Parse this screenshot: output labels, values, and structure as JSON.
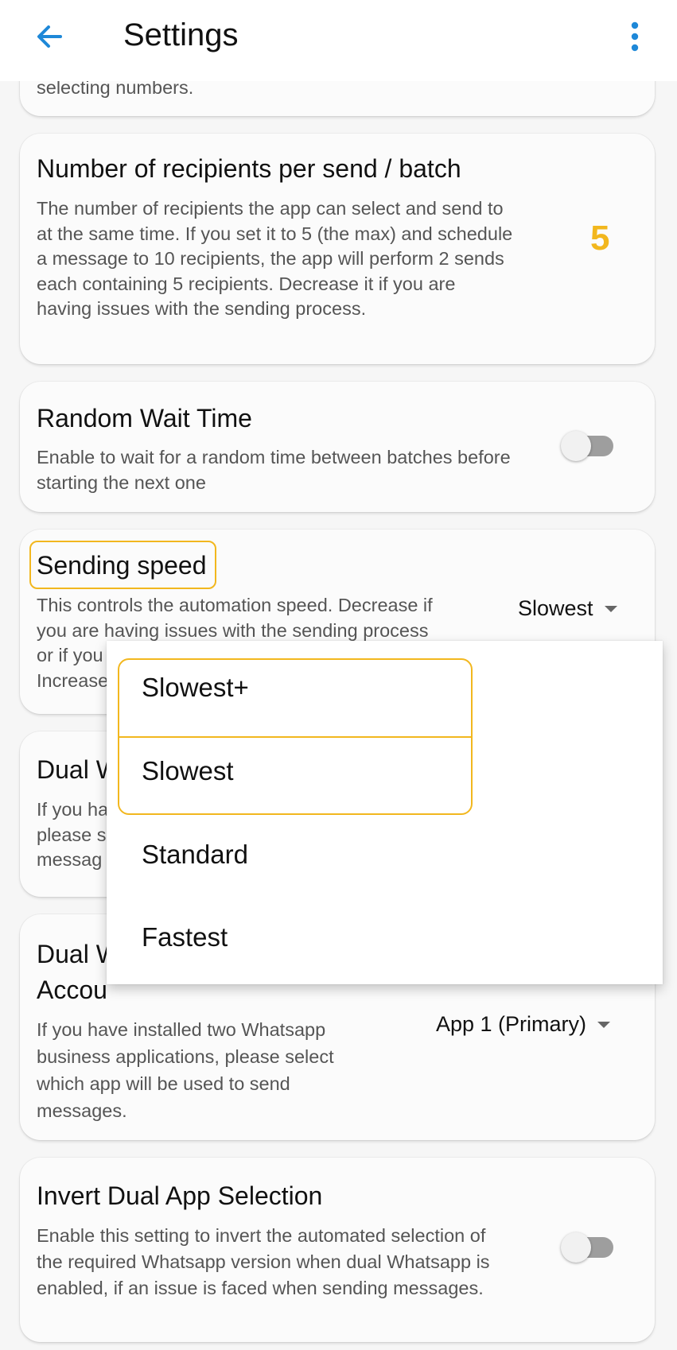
{
  "app_bar": {
    "title": "Settings",
    "back_icon": "arrow-left-icon",
    "more_icon": "more-vert-icon"
  },
  "partial_card": {
    "desc": "selecting numbers."
  },
  "recipients_card": {
    "title": "Number of recipients per send / batch",
    "desc": "The number of recipients the app can select and send to at the same time. If you set it to 5 (the max) and schedule a message to 10 recipients, the app will perform 2 sends each containing 5 recipients. Decrease it if you are having issues with the sending process.",
    "value": "5"
  },
  "random_wait_card": {
    "title": "Random Wait Time",
    "desc": "Enable to wait for a random time between batches before starting the next one",
    "enabled": false
  },
  "speed_card": {
    "title": "Sending speed",
    "desc_line1": "This controls the automation speed. Decrease if",
    "desc_line2": "you are having issues with the sending process",
    "desc_line3": "or if you",
    "desc_line4": "Increase",
    "selected": "Slowest"
  },
  "dual_card": {
    "title_fragment": "Dual W",
    "desc_line1": "If you ha",
    "desc_line2": "please s",
    "desc_line3": "messag"
  },
  "dual_account_card": {
    "title_line1": "Dual W",
    "title_line2": "Accou",
    "desc": "If you have installed two Whatsapp business applications, please select which app will be used to send messages.",
    "selected": "App 1 (Primary)"
  },
  "invert_card": {
    "title": "Invert Dual App Selection",
    "desc": "Enable this setting to invert the automated selection of the required Whatsapp version when dual Whatsapp is enabled, if an issue is faced when sending messages.",
    "enabled": false
  },
  "speed_dropdown": {
    "options": [
      "Slowest+",
      "Slowest",
      "Standard",
      "Fastest"
    ]
  },
  "colors": {
    "accent": "#f2b71e",
    "back_arrow": "#1e88d8",
    "toggle_off": "#9e9e9e"
  }
}
